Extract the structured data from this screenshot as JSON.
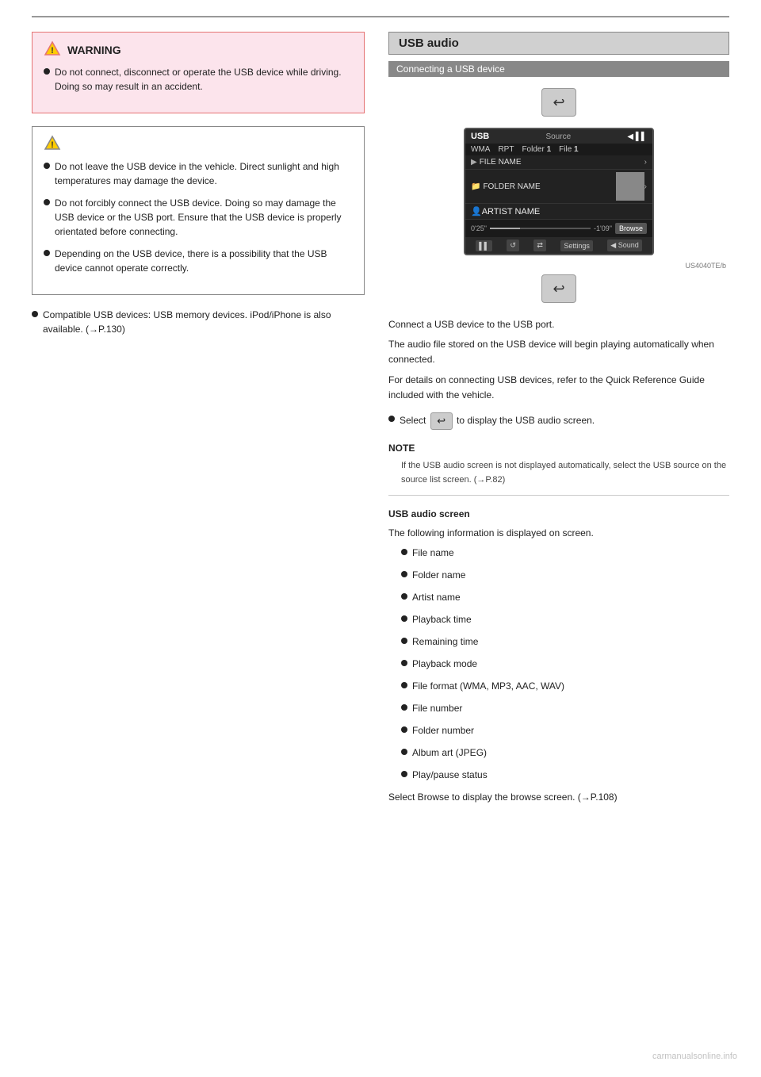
{
  "page": {
    "top_rule": true,
    "watermark": "carmanualsonline.info"
  },
  "left_column": {
    "warning_box": {
      "header": "WARNING",
      "bullet1": "Do not connect, disconnect or operate the USB device while driving. Doing so may result in an accident."
    },
    "caution_box": {
      "bullet1": "Do not leave the USB device in the vehicle. Direct sunlight and high temperatures may damage the device.",
      "bullet2": "Do not forcibly connect the USB device. Doing so may damage the USB device or the USB port. Ensure that the USB device is properly orientated before connecting.",
      "bullet3": "Depending on the USB device, there is a possibility that the USB device cannot operate correctly."
    },
    "body_bullet1": "Compatible USB devices: USB memory devices. iPod/iPhone is also available. (→P.130)"
  },
  "right_column": {
    "usb_audio_title": "USB audio",
    "subtitle_bar": "Connecting a USB device",
    "back_button_label": "back",
    "usb_screen": {
      "top_bar_left": "USB",
      "top_bar_source": "Source",
      "top_bar_icons": "◀ ▌▌",
      "wma_label": "WMA",
      "rpt_label": "RPT",
      "folder_label": "Folder",
      "folder_num": "1",
      "file_label": "File",
      "file_num": "1",
      "file_name_row": "FILE NAME",
      "folder_name_row": "FOLDER NAME",
      "artist_name_row": "ARTIST NAME",
      "time_start": "0'25\"",
      "time_end": "-1'09\"",
      "browse_btn": "Browse",
      "bottom_buttons": [
        "▌▌",
        "↺",
        "⇄",
        "Settings",
        "◀ Sound"
      ],
      "image_label": "US4040TE/b"
    },
    "body_text": {
      "para1": "Connect a USB device to the USB port.",
      "para2": "The audio file stored on the USB device will begin playing automatically when connected.",
      "para3": "For details on connecting USB devices, refer to the Quick Reference Guide included with the vehicle.",
      "back_button_note": "Select",
      "back_button_context": "to display the USB audio screen.",
      "note1_label": "NOTE",
      "note1_text": "If the USB audio screen is not displayed automatically, select the USB source on the source list screen. (→P.82)",
      "section2_title": "USB audio screen",
      "section2_para1": "The following information is displayed on screen.",
      "screen_items": [
        "File name",
        "Folder name",
        "Artist name",
        "Playback time",
        "Remaining time",
        "Playback mode",
        "File format (WMA, MP3, AAC, WAV)",
        "File number",
        "Folder number",
        "Album art (JPEG)",
        "Play/pause status"
      ],
      "section3_para": "Select Browse to display the browse screen. (→P.108)"
    }
  }
}
